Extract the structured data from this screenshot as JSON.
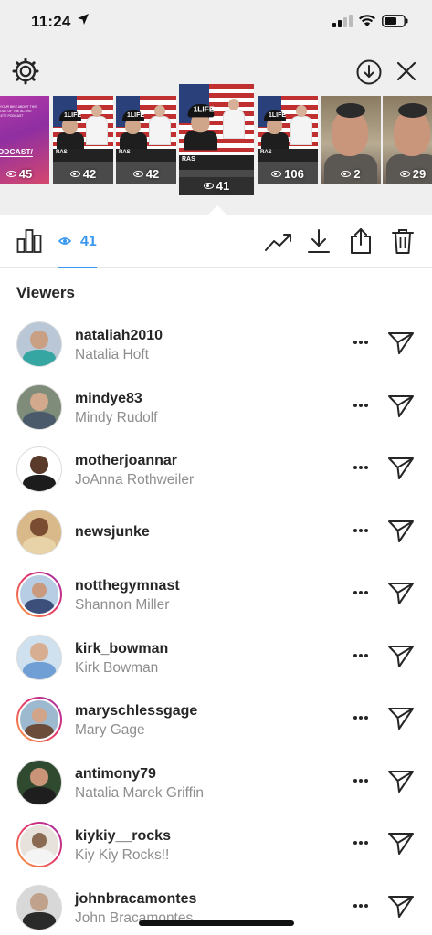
{
  "status_bar": {
    "time": "11:24"
  },
  "top_icons": {
    "settings": "gear-icon",
    "download_circle": "download-circle-icon",
    "close": "close-icon"
  },
  "story_thumbnails": [
    {
      "count": "45",
      "kind": "podcast",
      "lines": "ASK YOUR BIKE ABOUT THIS EPISODE OF THE ACTIVE ATHLETE PODCAST",
      "label": "PODCAST/"
    },
    {
      "count": "42",
      "kind": "flag",
      "cap": "1LIFE",
      "band": "RAS"
    },
    {
      "count": "42",
      "kind": "flag",
      "cap": "1LIFE",
      "band": "RAS"
    },
    {
      "count": "41",
      "kind": "flag",
      "cap": "1LIFE",
      "band": "RAS",
      "active": true
    },
    {
      "count": "106",
      "kind": "flag",
      "cap": "1LIFE",
      "band": "RAS"
    },
    {
      "count": "2",
      "kind": "selfie"
    },
    {
      "count": "29",
      "kind": "selfie"
    }
  ],
  "toolbar": {
    "insights_icon": "bar-chart-icon",
    "viewers_count": "41",
    "actions": [
      "trend-icon",
      "download-icon",
      "share-icon",
      "trash-icon"
    ]
  },
  "viewers_section": {
    "title": "Viewers",
    "items": [
      {
        "username": "nataliah2010",
        "name": "Natalia Hoft",
        "ring": false,
        "bg": "#b9c7d6",
        "head": "#caa084",
        "body": "#35a6a2"
      },
      {
        "username": "mindye83",
        "name": "Mindy Rudolf",
        "ring": false,
        "bg": "#7f8c7a",
        "head": "#d2a98c",
        "body": "#4a5a6a"
      },
      {
        "username": "motherjoannar",
        "name": "JoAnna Rothweiler",
        "ring": false,
        "bg": "#ffffff",
        "head": "#5a3a2a",
        "body": "#1c1c1c"
      },
      {
        "username": "newsjunke",
        "name": "",
        "ring": false,
        "bg": "#d9b98a",
        "head": "#7a4c32",
        "body": "#e8d3a8"
      },
      {
        "username": "notthegymnast",
        "name": "Shannon Miller",
        "ring": true,
        "bg": "#b7cde3",
        "head": "#c99a7e",
        "body": "#3b4f7a"
      },
      {
        "username": "kirk_bowman",
        "name": "Kirk Bowman",
        "ring": false,
        "bg": "#cfe0ee",
        "head": "#d8ae92",
        "body": "#6f9fd4"
      },
      {
        "username": "maryschlessgage",
        "name": "Mary Gage",
        "ring": true,
        "bg": "#9cb9cf",
        "head": "#d2a48a",
        "body": "#6b4c3a"
      },
      {
        "username": "antimony79",
        "name": "Natalia Marek Griffin",
        "ring": false,
        "bg": "#2f4a2e",
        "head": "#c99478",
        "body": "#1e1e1e"
      },
      {
        "username": "kiykiy__rocks",
        "name": "Kiy Kiy Rocks!!",
        "ring": true,
        "bg": "#e7e3dc",
        "head": "#8a6a52",
        "body": "#f4f4f4"
      },
      {
        "username": "johnbracamontes",
        "name": "John Bracamontes",
        "ring": false,
        "bg": "#d8d8d8",
        "head": "#bfa18c",
        "body": "#2a2a2a"
      }
    ]
  }
}
